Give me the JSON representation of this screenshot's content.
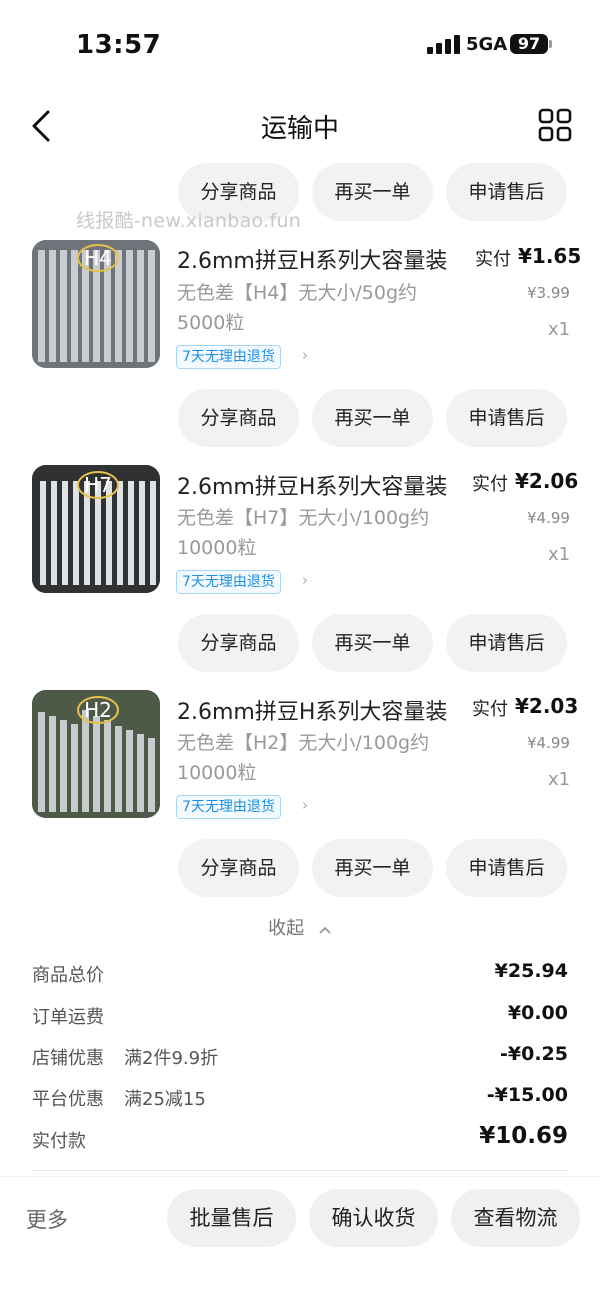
{
  "status": {
    "time": "13:57",
    "network": "5GA",
    "battery": "97"
  },
  "nav": {
    "title": "运输中"
  },
  "watermark": "线报酷-new.xianbao.fun",
  "actions": {
    "share": "分享商品",
    "rebuy": "再买一单",
    "after_sale": "申请售后"
  },
  "items": [
    {
      "title": "2.6mm拼豆H系列大容量装",
      "spec": "无色差【H4】无大小/50g约5000粒",
      "tag": "7天无理由退货",
      "thumb_label": "H4",
      "paid_label": "实付",
      "paid": "¥1.65",
      "original": "¥3.99",
      "qty": "x1"
    },
    {
      "title": "2.6mm拼豆H系列大容量装",
      "spec": "无色差【H7】无大小/100g约10000粒",
      "tag": "7天无理由退货",
      "thumb_label": "H7",
      "paid_label": "实付",
      "paid": "¥2.06",
      "original": "¥4.99",
      "qty": "x1"
    },
    {
      "title": "2.6mm拼豆H系列大容量装",
      "spec": "无色差【H2】无大小/100g约10000粒",
      "tag": "7天无理由退货",
      "thumb_label": "H2",
      "paid_label": "实付",
      "paid": "¥2.03",
      "original": "¥4.99",
      "qty": "x1"
    }
  ],
  "collapse_label": "收起",
  "summary": {
    "goods_total_label": "商品总价",
    "goods_total": "¥25.94",
    "shipping_label": "订单运费",
    "shipping": "¥0.00",
    "shop_discount_label": "店铺优惠",
    "shop_discount_desc": "满2件9.9折",
    "shop_discount": "-¥0.25",
    "platform_discount_label": "平台优惠",
    "platform_discount_desc": "满25减15",
    "platform_discount": "-¥15.00",
    "paid_label": "实付款",
    "paid": "¥10.69"
  },
  "bottom": {
    "more": "更多",
    "batch_after_sale": "批量售后",
    "confirm_receipt": "确认收货",
    "view_logistics": "查看物流"
  },
  "icons": [
    "signal-icon",
    "battery-icon",
    "back-chevron-icon",
    "grid-menu-icon",
    "chevron-right-icon",
    "chevron-up-icon"
  ],
  "colors": {
    "tag_blue": "#1d8fe0",
    "pill_bg": "#f2f2f2"
  }
}
